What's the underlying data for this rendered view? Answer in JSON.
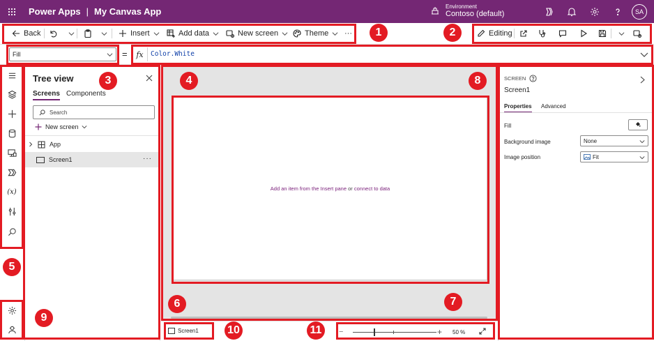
{
  "titlebar": {
    "product": "Power Apps",
    "separator": "|",
    "app_title": "My Canvas App",
    "environment_label": "Environment",
    "environment_value": "Contoso (default)",
    "user_initials": "SA"
  },
  "command_bar": {
    "back": "Back",
    "insert": "Insert",
    "add_data": "Add data",
    "new_screen": "New screen",
    "theme": "Theme",
    "more": "···",
    "editing": "Editing"
  },
  "formula_bar": {
    "property": "Fill",
    "equals": "=",
    "fx": "fx",
    "formula": "Color.White"
  },
  "tree_view": {
    "title": "Tree view",
    "tabs": [
      "Screens",
      "Components"
    ],
    "search_placeholder": "Search",
    "new_screen": "New screen",
    "items": [
      {
        "label": "App"
      },
      {
        "label": "Screen1",
        "more": "···"
      }
    ]
  },
  "canvas": {
    "hint_prefix": "Add an item from the Insert pane",
    "hint_or": "or",
    "hint_link": "connect to data"
  },
  "status_bar": {
    "screen_tab": "Screen1",
    "zoom_minus": "−",
    "zoom_plus": "+",
    "zoom_value": "50  %",
    "zoom_level_percent": 50
  },
  "properties": {
    "type_label": "SCREEN",
    "name": "Screen1",
    "tabs": [
      "Properties",
      "Advanced"
    ],
    "fill_label": "Fill",
    "background_image_label": "Background image",
    "background_image_value": "None",
    "image_position_label": "Image position",
    "image_position_value": "Fit"
  },
  "callouts": [
    "1",
    "2",
    "3",
    "4",
    "5",
    "6",
    "7",
    "8",
    "9",
    "10",
    "11"
  ],
  "colors": {
    "brand": "#742774",
    "callout": "#e31b23",
    "canvas_background": "#e4e4e4",
    "formula_text": "#0f3fa8"
  }
}
